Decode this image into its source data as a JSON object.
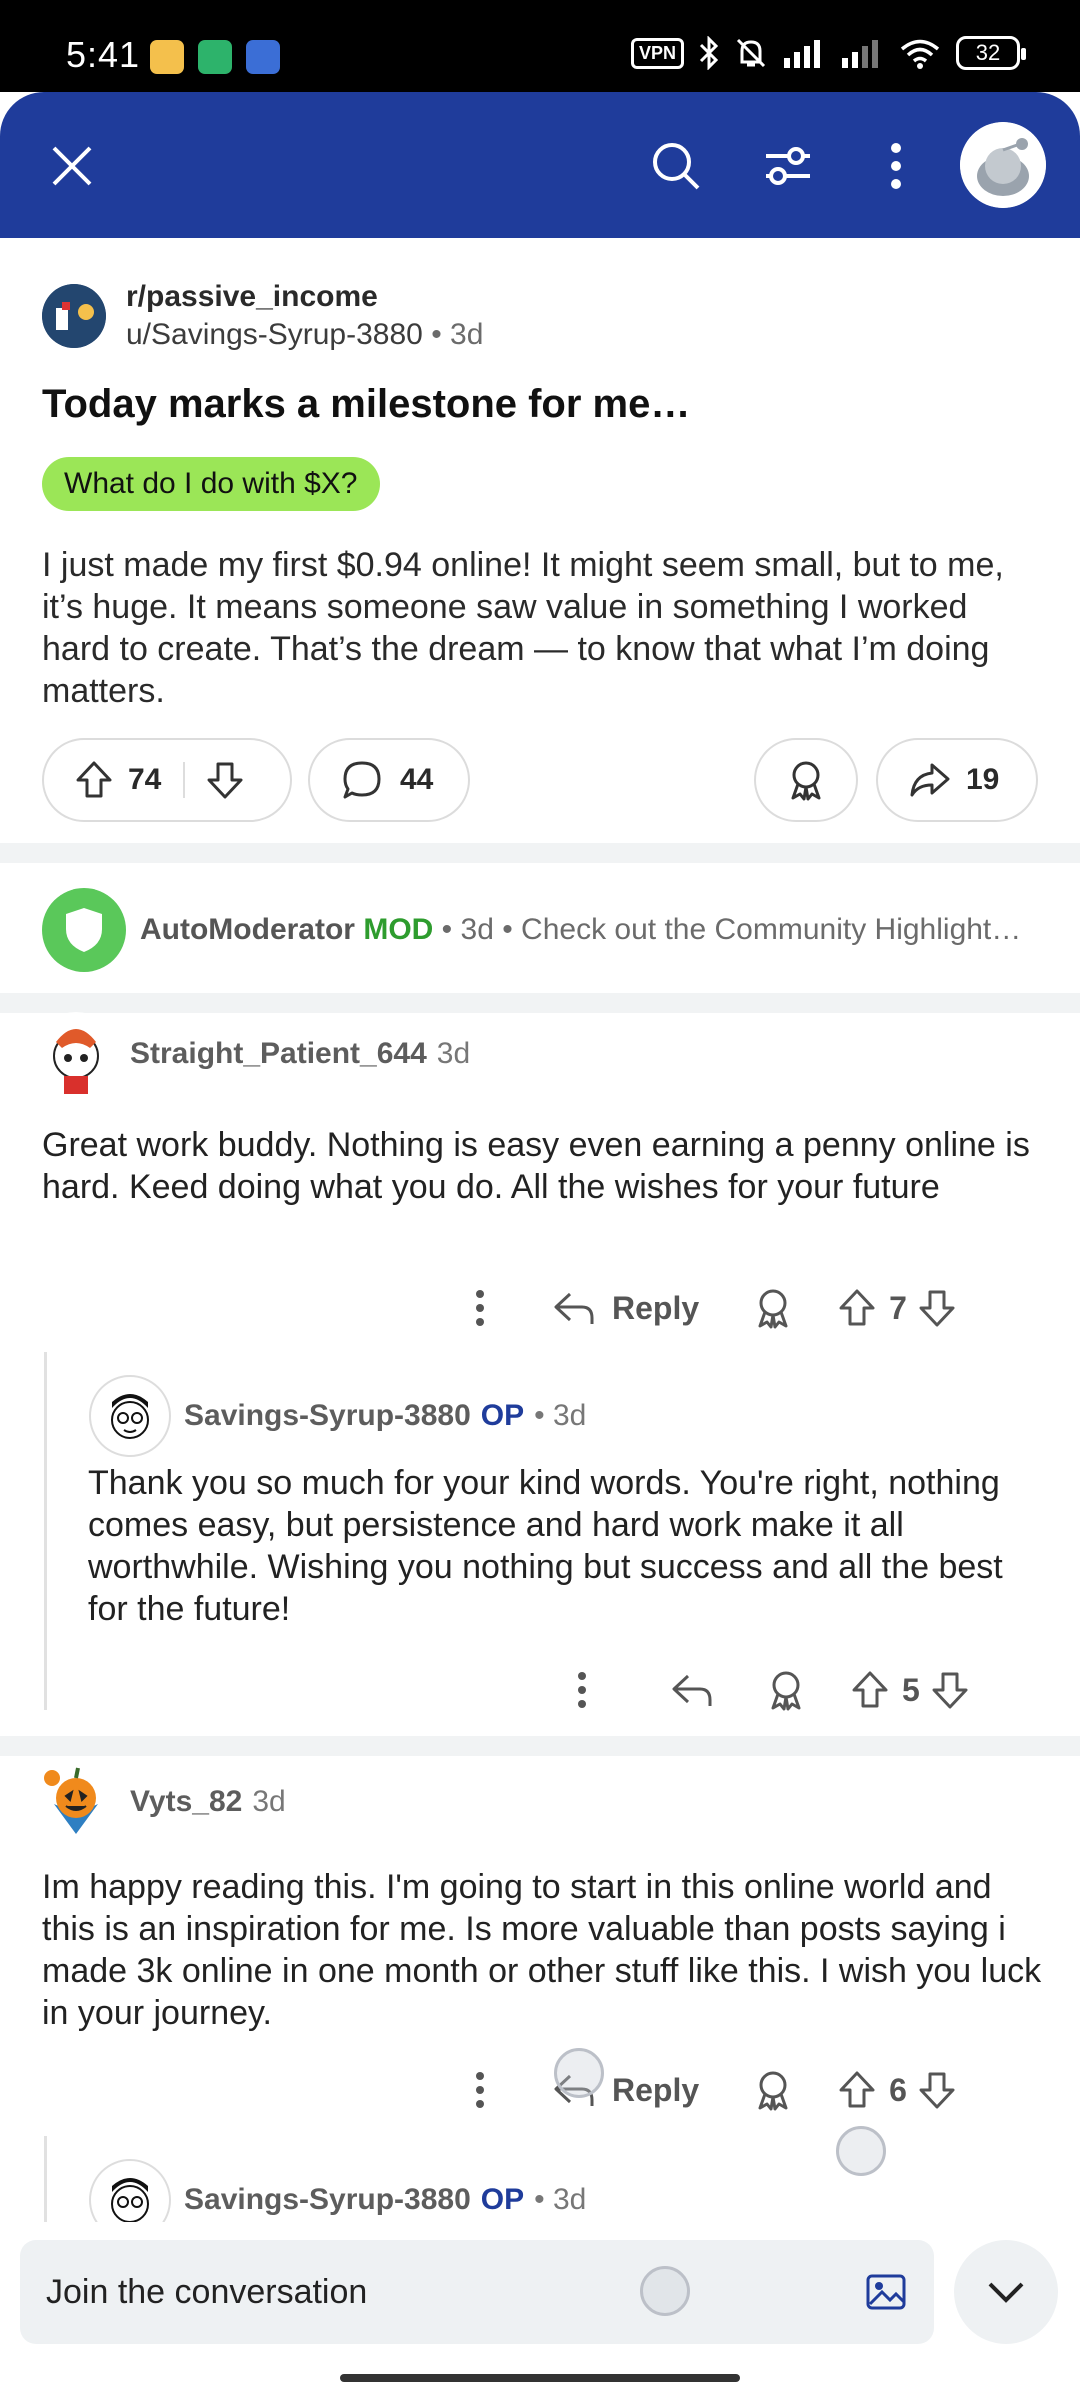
{
  "status_bar": {
    "time": "5:41",
    "vpn": "VPN",
    "battery": "32"
  },
  "header": {
    "close_icon": "close-icon",
    "search_icon": "search-icon",
    "filter_icon": "filter-icon",
    "more_icon": "more-vertical-icon"
  },
  "post": {
    "subreddit": "r/passive_income",
    "author": "u/Savings-Syrup-3880",
    "time": "3d",
    "title": "Today marks a milestone for me…",
    "flair": "What do I do with $X?",
    "flair_color": "#9be657",
    "body": "I just made my first $0.94 online! It might seem small, but to me, it’s huge. It means someone saw value in something I worked hard to create. That’s the dream — to know that what I’m doing matters.",
    "upvotes": "74",
    "comments": "44",
    "shares": "19"
  },
  "automod": {
    "name": "AutoModerator",
    "badge": "MOD",
    "meta": "• 3d • Check out the Community Highlight…"
  },
  "comments": [
    {
      "author": "Straight_Patient_644",
      "time": "3d",
      "body": "Great work buddy. Nothing is easy even earning a penny online is hard. Keed doing what you do. All the wishes for your future",
      "reply_label": "Reply",
      "votes": "7"
    },
    {
      "author": "Savings-Syrup-3880",
      "op": "OP",
      "time": "• 3d",
      "body": "Thank you so much for your kind words. You're right, nothing comes easy, but persistence and hard work make it all worthwhile. Wishing you nothing but success and all the best for the future!",
      "votes": "5"
    },
    {
      "author": "Vyts_82",
      "time": "3d",
      "body": "Im happy reading this. I'm going to start in this online world and this is an inspiration for me. Is more valuable than posts saying i made 3k online in one month or other stuff like this. I wish you luck in your journey.",
      "reply_label": "Reply",
      "votes": "6"
    },
    {
      "author": "Savings-Syrup-3880",
      "op": "OP",
      "time": "• 3d"
    }
  ],
  "composer": {
    "placeholder": "Join the conversation"
  },
  "colors": {
    "header": "#1f3c9b",
    "mod_green": "#2e9c2e",
    "op_blue": "#1f3c9b"
  }
}
